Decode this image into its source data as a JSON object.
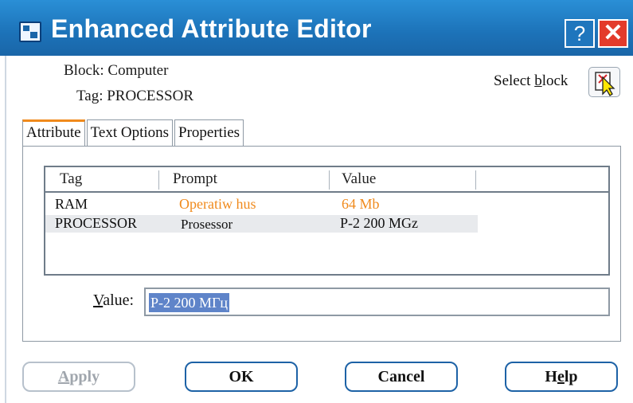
{
  "window": {
    "title": "Enhanced Attribute Editor",
    "help_label": "?",
    "close_label": "✕"
  },
  "info": {
    "block_text": "Block: Computer",
    "tag_text": "Tag: PROCESSOR",
    "select_block_label_pre": "Select ",
    "select_block_label_mnemonic": "b",
    "select_block_label_post": "lock"
  },
  "tabs": [
    {
      "label": "Attribute",
      "active": true
    },
    {
      "label": "Text Options",
      "active": false
    },
    {
      "label": "Properties",
      "active": false
    }
  ],
  "list": {
    "columns": [
      "Tag",
      "Prompt",
      "Value"
    ],
    "rows": [
      {
        "tag": "RAM",
        "prompt": "Operatiw hus",
        "value": "64 Mb",
        "highlight_color": "#f08a1c"
      },
      {
        "tag": "PROCESSOR",
        "prompt": "Prosessor",
        "value": "P-2 200 MGz",
        "selected": true
      }
    ]
  },
  "value_field": {
    "label_mnemonic": "V",
    "label_rest": "alue:",
    "value": "P-2 200 МГц"
  },
  "buttons": {
    "apply_mnemonic": "A",
    "apply_rest": "pply",
    "ok": "OK",
    "cancel": "Cancel",
    "help_pre": "H",
    "help_mnemonic": "e",
    "help_post": "lp"
  },
  "colors": {
    "titlebar": "#1c72b8",
    "accent_orange": "#f08a1c",
    "selection": "#5f84c9"
  }
}
